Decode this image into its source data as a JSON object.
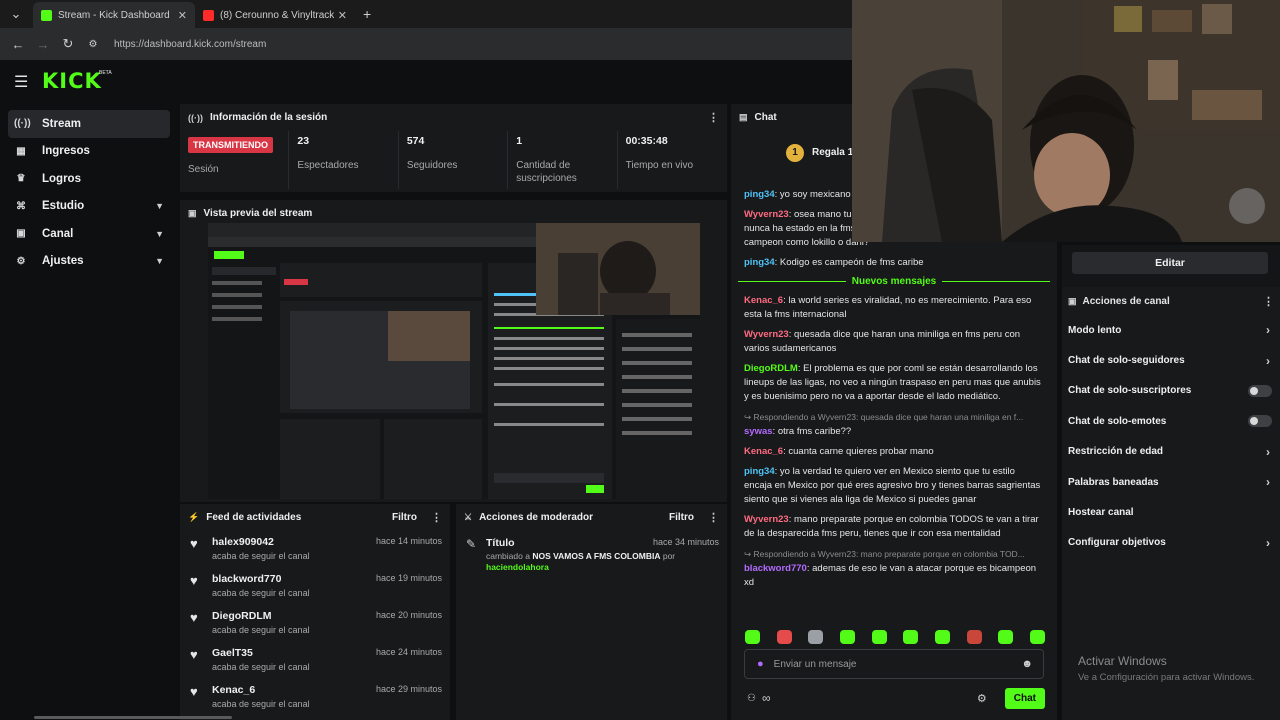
{
  "browser": {
    "tabs": [
      {
        "title": "Stream - Kick Dashboard",
        "favicon_color": "#53fc18"
      },
      {
        "title": "(8) Cerounno & Vinyltracker - E",
        "favicon_color": "#ff2b2b"
      }
    ],
    "url": "https://dashboard.kick.com/stream"
  },
  "app": {
    "logo": "KICK",
    "logo_badge": "BETA"
  },
  "sidebar": {
    "items": [
      {
        "label": "Stream",
        "icon": "broadcast-icon",
        "glyph": "((·))",
        "active": true,
        "expand": false
      },
      {
        "label": "Ingresos",
        "icon": "chart-icon",
        "glyph": "▦",
        "active": false,
        "expand": false
      },
      {
        "label": "Logros",
        "icon": "trophy-icon",
        "glyph": "🏆",
        "active": false,
        "expand": false
      },
      {
        "label": "Estudio",
        "icon": "studio-icon",
        "glyph": "⌘",
        "active": false,
        "expand": true
      },
      {
        "label": "Canal",
        "icon": "channel-icon",
        "glyph": "▣",
        "active": false,
        "expand": true
      },
      {
        "label": "Ajustes",
        "icon": "gear-icon",
        "glyph": "⚙",
        "active": false,
        "expand": true
      }
    ]
  },
  "session": {
    "title": "Información de la sesión",
    "status_badge": "TRANSMITIENDO",
    "status_label": "Sesión",
    "stats": [
      {
        "value": "23",
        "label": "Espectadores"
      },
      {
        "value": "574",
        "label": "Seguidores"
      },
      {
        "value": "1",
        "label": "Cantidad de suscripciones"
      },
      {
        "value": "00:35:48",
        "label": "Tiempo en vivo"
      }
    ]
  },
  "preview": {
    "title": "Vista previa del stream"
  },
  "activity": {
    "title": "Feed de actividades",
    "filter": "Filtro",
    "items": [
      {
        "name": "halex909042",
        "sub": "acaba de seguir el canal",
        "time": "hace 14 minutos"
      },
      {
        "name": "blackword770",
        "sub": "acaba de seguir el canal",
        "time": "hace 19 minutos"
      },
      {
        "name": "DiegoRDLM",
        "sub": "acaba de seguir el canal",
        "time": "hace 20 minutos"
      },
      {
        "name": "GaelT35",
        "sub": "acaba de seguir el canal",
        "time": "hace 24 minutos"
      },
      {
        "name": "Kenac_6",
        "sub": "acaba de seguir el canal",
        "time": "hace 29 minutos"
      }
    ]
  },
  "moderator": {
    "title": "Acciones de moderador",
    "filter": "Filtro",
    "item": {
      "title": "Título",
      "time": "hace 34 minutos",
      "prefix": "cambiado a",
      "new_title": "NOS VAMOS A FMS COLOMBIA",
      "by": "por",
      "user": "haciendolahora"
    }
  },
  "chat": {
    "title": "Chat",
    "gift_text": "Regala 1 s",
    "new_messages": "Nuevos mensajes",
    "messages": [
      {
        "user": "ping34",
        "color": "#4fc3f7",
        "text": "yo soy mexicano y en serio como van a subir el nivel",
        "reply": ""
      },
      {
        "user": "Wyvern23",
        "color": "#ff6b81",
        "text": "osea mano tu dijiste que no podian poner a gente que nunca ha estado en la fms como kodigo o uno que nunca ha sido campeon como lokillo o dani?",
        "reply": ""
      },
      {
        "user": "ping34",
        "color": "#4fc3f7",
        "text": "Kodigo es campeón de fms caribe",
        "reply": ""
      }
    ],
    "new_list": [
      {
        "user": "Kenac_6",
        "color": "#ff6b81",
        "text": "la world series es viralidad, no es merecimiento. Para eso esta la fms internacional",
        "reply": ""
      },
      {
        "user": "Wyvern23",
        "color": "#ff6b81",
        "text": "quesada dice que haran una miniliga en fms peru con varios sudamericanos",
        "reply": ""
      },
      {
        "user": "DiegoRDLM",
        "color": "#53fc18",
        "text": "El problema es que por coml se están desarrollando los lineups de las ligas, no veo a ningún traspaso en peru mas que anubis y es buenisimo pero no va a aportar desde el lado mediático.",
        "reply": ""
      },
      {
        "user": "sywas",
        "color": "#b36bff",
        "text": "otra fms caribe??",
        "reply": "Respondiendo a Wyvern23: quesada dice que haran una miniliga en f..."
      },
      {
        "user": "Kenac_6",
        "color": "#ff6b81",
        "text": "cuanta carne quieres probar mano",
        "reply": ""
      },
      {
        "user": "ping34",
        "color": "#4fc3f7",
        "text": "yo la verdad te quiero ver en Mexico siento que tu estilo encaja en Mexico por qué eres agresivo bro y tienes barras sagrientas siento que si vienes ala liga de Mexico si puedes ganar",
        "reply": ""
      },
      {
        "user": "Wyvern23",
        "color": "#ff6b81",
        "text": "mano preparate porque en colombia TODOS te van a tirar de la desparecida fms peru, tienes que ir con esa mentalidad",
        "reply": ""
      },
      {
        "user": "blackword770",
        "color": "#b36bff",
        "text": "ademas de eso le van a atacar porque es bicampeon xd",
        "reply": "Respondiendo a Wyvern23: mano preparate porque en colombia TOD..."
      }
    ],
    "emote_colors": [
      "#53fc18",
      "#e54b4b",
      "#9aa0a6",
      "#53fc18",
      "#53fc18",
      "#53fc18",
      "#53fc18",
      "#c9473a",
      "#53fc18",
      "#53fc18"
    ],
    "input_placeholder": "Enviar un mensaje",
    "send_label": "Chat"
  },
  "channel_actions": {
    "edit_label": "Editar",
    "title": "Acciones de canal",
    "items": [
      {
        "label": "Modo lento",
        "control": "arrow"
      },
      {
        "label": "Chat de solo-seguidores",
        "control": "arrow"
      },
      {
        "label": "Chat de solo-suscriptores",
        "control": "toggle"
      },
      {
        "label": "Chat de solo-emotes",
        "control": "toggle"
      },
      {
        "label": "Restricción de edad",
        "control": "arrow"
      },
      {
        "label": "Palabras baneadas",
        "control": "arrow"
      },
      {
        "label": "Hostear canal",
        "control": "none"
      },
      {
        "label": "Configurar objetivos",
        "control": "arrow"
      }
    ]
  },
  "watermark": {
    "line1": "Activar Windows",
    "line2": "Ve a Configuración para activar Windows."
  }
}
